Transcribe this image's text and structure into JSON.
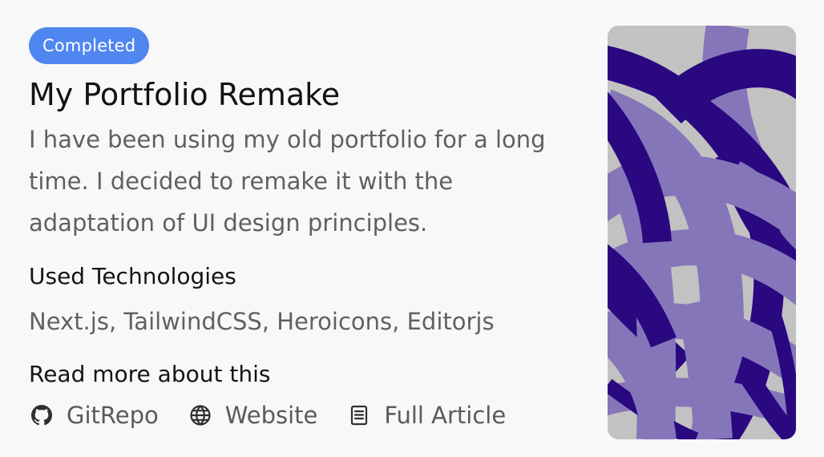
{
  "project": {
    "status_badge": "Completed",
    "title": "My Portfolio Remake",
    "description": "I have been using my old portfolio for a long time. I decided to remake it with the adaptation of UI design principles.",
    "technologies_heading": "Used Technologies",
    "technologies": "Next.js, TailwindCSS, Heroicons, Editorjs",
    "read_more_heading": "Read more about this",
    "links": [
      {
        "label": "GitRepo",
        "icon": "github-icon"
      },
      {
        "label": "Website",
        "icon": "globe-icon"
      },
      {
        "label": "Full Article",
        "icon": "article-icon"
      }
    ]
  },
  "colors": {
    "badge": "#4F86EF",
    "title_text": "#121212",
    "body_text": "#5F5F5F",
    "background": "#F8F8F8",
    "cover_background": "#C2C2C2",
    "cover_light_purple": "#8576BA",
    "cover_dark_purple": "#2A0880"
  },
  "cover_image": {
    "icon": "abstract-purple-arcs-image"
  }
}
